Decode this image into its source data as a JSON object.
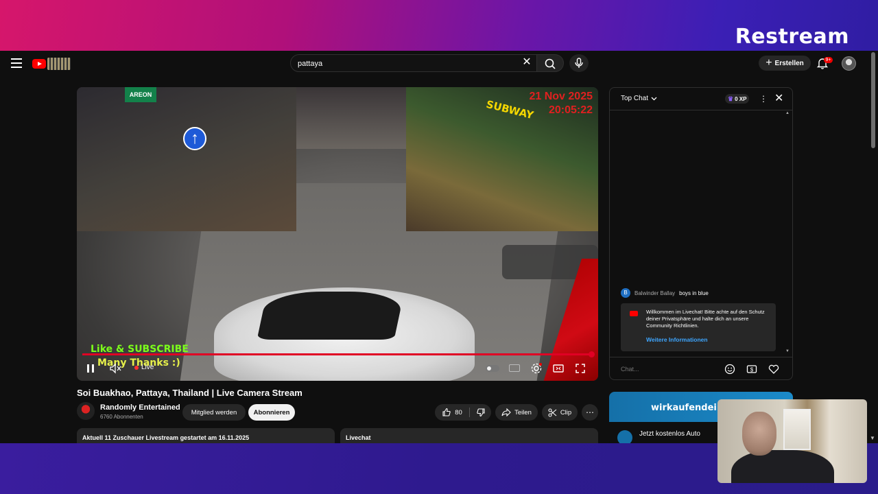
{
  "branding": {
    "logo_text": "Restream"
  },
  "topbar": {
    "search_value": "pattaya",
    "create_label": "Erstellen",
    "notification_badge": "9+"
  },
  "video": {
    "timestamp_date": "21 Nov 2025",
    "timestamp_time": "20:05:22",
    "overlay_line1": "Like & SUBSCRIBE",
    "overlay_line2": "Many Thanks :)",
    "street_sign": "AREON",
    "store_sign": "SUBWAY",
    "live_label": "Live",
    "progress_fraction": 1.0,
    "title": "Soi Buakhao, Pattaya, Thailand | Live Camera Stream"
  },
  "channel": {
    "name": "Randomly Entertained",
    "subscribers": "6760 Abonnenten",
    "join_label": "Mitglied werden",
    "subscribe_label": "Abonnieren"
  },
  "actions": {
    "like_count": "80",
    "share_label": "Teilen",
    "clip_label": "Clip"
  },
  "info": {
    "stats_text": "Aktuell 11 Zuschauer  Livestream gestartet am 16.11.2025",
    "livechat_label": "Livechat"
  },
  "chat": {
    "mode_label": "Top Chat",
    "xp_label": "0 XP",
    "messages": [
      {
        "avatar_letter": "B",
        "author": "Balwinder Ballay",
        "text": "boys in blue"
      }
    ],
    "welcome_text": "Willkommen im Livechat! Bitte achte auf den Schutz deiner Privatsphäre und halte dich an unsere Community Richtlinien.",
    "welcome_link": "Weitere Informationen",
    "input_placeholder": "Chat..."
  },
  "ad": {
    "brand": "wirkaufendein",
    "text": "Jetzt kostenlos Auto"
  },
  "colors": {
    "accent_red": "#ff0000",
    "link_blue": "#3ea6ff",
    "background_dark": "#0f0f0f"
  }
}
